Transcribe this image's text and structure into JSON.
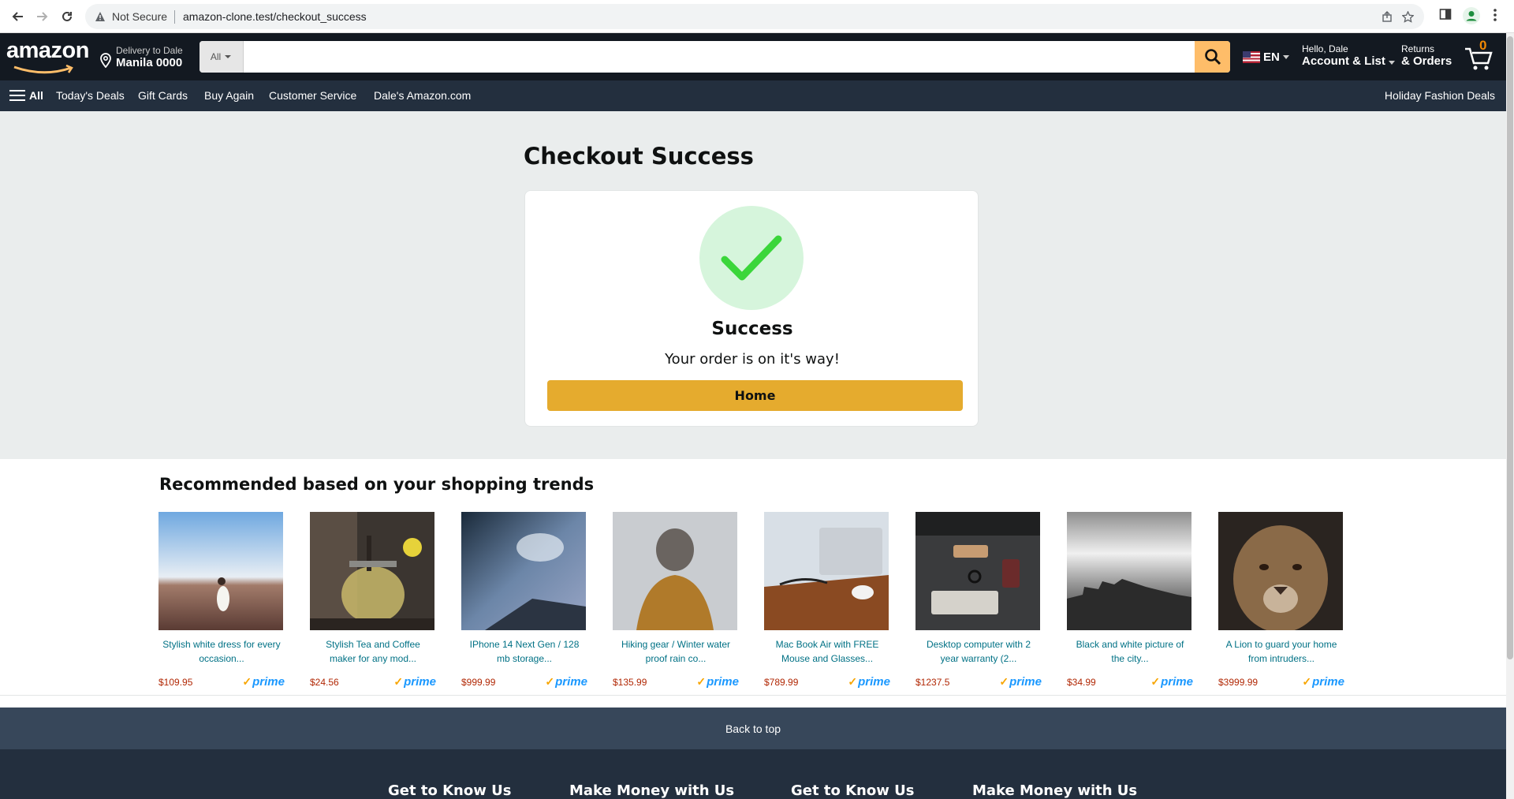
{
  "browser": {
    "security_label": "Not Secure",
    "url": "amazon-clone.test/checkout_success"
  },
  "header": {
    "logo_text": "amazon",
    "delivery_line1": "Delivery to Dale",
    "delivery_line2": "Manila 0000",
    "search_category": "All",
    "search_placeholder": "",
    "language": "EN",
    "greeting": "Hello, Dale",
    "account_label": "Account & List",
    "returns_line1": "Returns",
    "returns_line2": "& Orders",
    "cart_count": "0",
    "accent_color": "#febd69"
  },
  "subnav": {
    "all_label": "All",
    "items": [
      "Today's Deals",
      "Gift Cards",
      "Buy Again",
      "Customer Service",
      "Dale's Amazon.com"
    ],
    "right_item": "Holiday Fashion Deals"
  },
  "main": {
    "title": "Checkout Success",
    "success_heading": "Success",
    "success_message": "Your order is on it's way!",
    "home_button": "Home",
    "check_color": "#3bd63b"
  },
  "recommendations": {
    "title": "Recommended based on your shopping trends",
    "prime_label": "prime",
    "products": [
      {
        "name": "Stylish white dress for every occasion...",
        "price": "$109.95",
        "image": "woman-in-desert"
      },
      {
        "name": "Stylish Tea and Coffee maker for any mod...",
        "price": "$24.56",
        "image": "french-press"
      },
      {
        "name": "IPhone 14 Next Gen / 128 mb storage...",
        "price": "$999.99",
        "image": "phone-closeup"
      },
      {
        "name": "Hiking gear / Winter water proof rain co...",
        "price": "$135.99",
        "image": "person-in-beanie"
      },
      {
        "name": "Mac Book Air with FREE Mouse and Glasses...",
        "price": "$789.99",
        "image": "laptop-on-desk"
      },
      {
        "name": "Desktop computer with 2 year warranty (2...",
        "price": "$1237.5",
        "image": "desk-flatlay"
      },
      {
        "name": "Black and white picture of the city...",
        "price": "$34.99",
        "image": "city-skyline"
      },
      {
        "name": "A Lion to guard your home from intruders...",
        "price": "$3999.99",
        "image": "lioness"
      }
    ]
  },
  "footer": {
    "back_to_top": "Back to top",
    "headings": [
      "Get to Know Us",
      "Make Money with Us",
      "Get to Know Us",
      "Make Money with Us"
    ]
  }
}
